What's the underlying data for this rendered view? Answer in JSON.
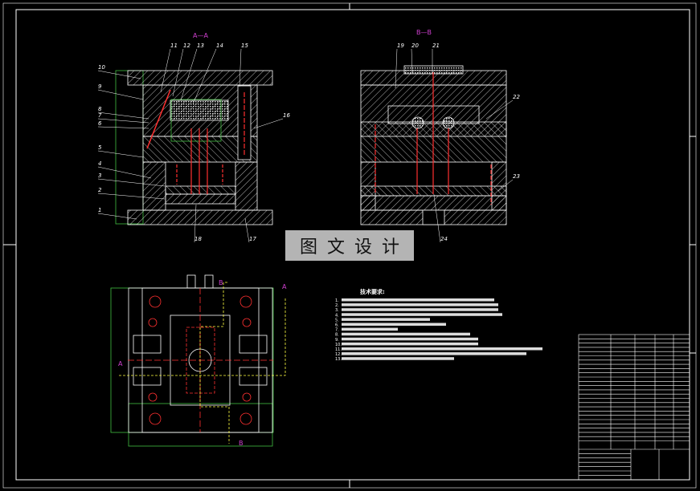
{
  "watermark": {
    "chars": [
      "图",
      "文",
      "设",
      "计"
    ]
  },
  "views": {
    "section_a": "A—A",
    "section_b": "B—B",
    "plan_markers": [
      "A",
      "A",
      "B",
      "B"
    ]
  },
  "part_numbers_a": [
    "10",
    "9",
    "8",
    "7",
    "6",
    "5",
    "4",
    "3",
    "2",
    "1",
    "11",
    "12",
    "13",
    "14",
    "15",
    "16",
    "18",
    "17"
  ],
  "part_numbers_b": [
    "19",
    "20",
    "21",
    "22",
    "23",
    "24"
  ],
  "tech_requirements": {
    "title": "技术要求:",
    "item_numbers": [
      "1.",
      "2.",
      "3.",
      "4.",
      "5.",
      "6.",
      "7.",
      "8.",
      "9.",
      "10.",
      "11.",
      "12.",
      "13."
    ]
  },
  "colors": {
    "background": "#000000",
    "lines": "#ffffff",
    "hatch": "#ffffff",
    "centerline": "#ff3030",
    "dimension": "#40c040",
    "section": "#d040d0",
    "cutline": "#ffff40"
  }
}
